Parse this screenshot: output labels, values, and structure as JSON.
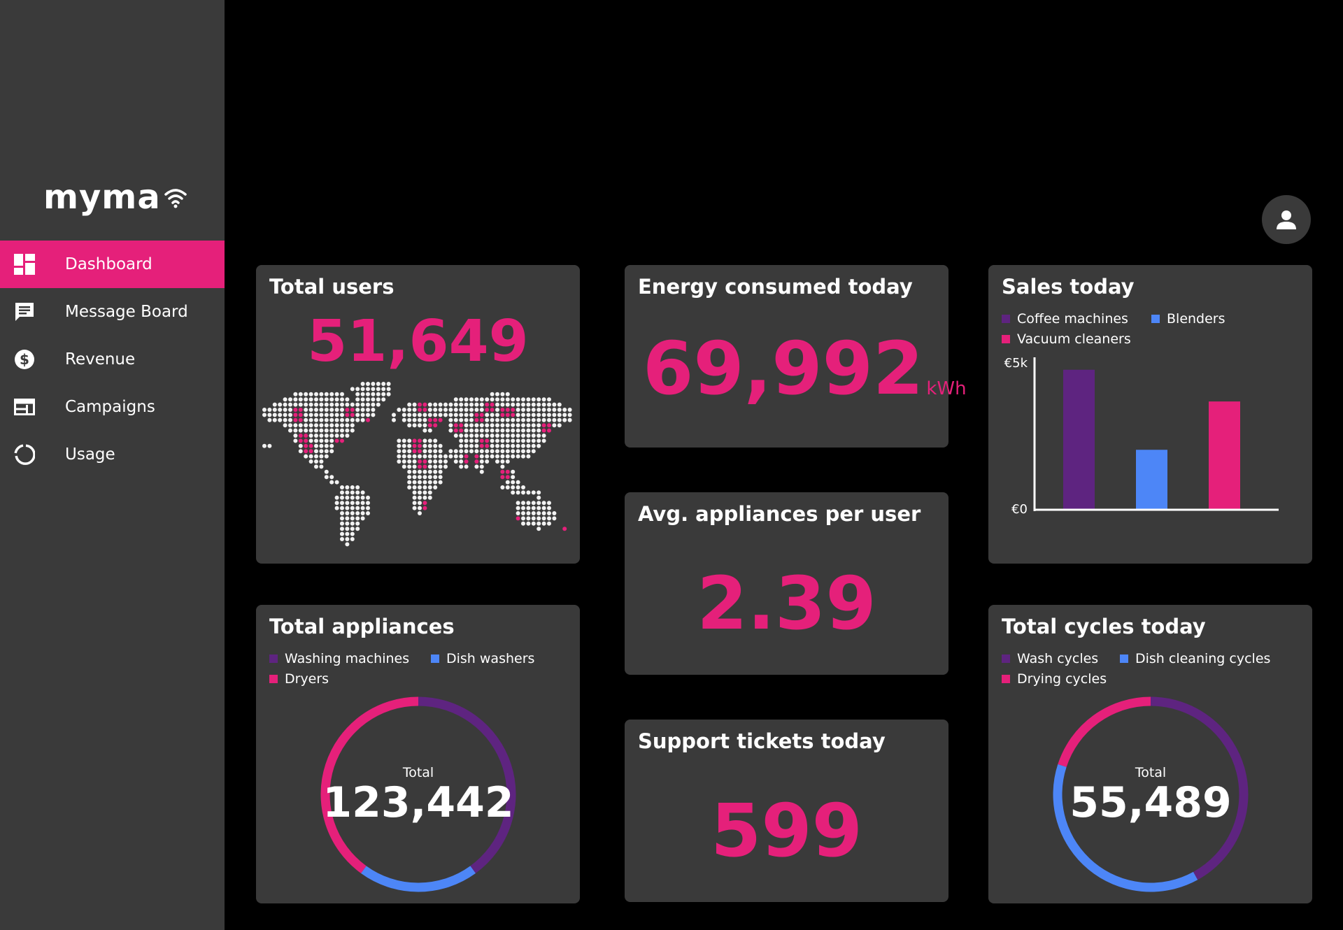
{
  "app": {
    "name": "myma"
  },
  "sidebar": {
    "items": [
      {
        "label": "Dashboard",
        "icon": "dashboard-icon",
        "active": true
      },
      {
        "label": "Message Board",
        "icon": "message-icon",
        "active": false
      },
      {
        "label": "Revenue",
        "icon": "dollar-icon",
        "active": false
      },
      {
        "label": "Campaigns",
        "icon": "campaigns-icon",
        "active": false
      },
      {
        "label": "Usage",
        "icon": "usage-icon",
        "active": false
      }
    ]
  },
  "header": {
    "avatar_icon": "user-icon"
  },
  "colors": {
    "accent": "#e5207a",
    "purple": "#5e2480",
    "blue": "#4d86f7",
    "card": "#3a3a3a",
    "sidebar": "#3a3a3a"
  },
  "cards": {
    "total_users": {
      "title": "Total users",
      "value": "51,649"
    },
    "energy": {
      "title": "Energy consumed today",
      "value": "69,992",
      "unit": "kWh"
    },
    "avg_appliances": {
      "title": "Avg. appliances per user",
      "value": "2.39"
    },
    "support": {
      "title": "Support tickets today",
      "value": "599"
    },
    "sales": {
      "title": "Sales today",
      "legend": [
        "Coffee machines",
        "Blenders",
        "Vacuum cleaners"
      ]
    },
    "total_appliances": {
      "title": "Total appliances",
      "legend": [
        "Washing machines",
        "Dish washers",
        "Dryers"
      ],
      "center_label": "Total",
      "center_value": "123,442"
    },
    "total_cycles": {
      "title": "Total cycles today",
      "legend": [
        "Wash cycles",
        "Dish cleaning cycles",
        "Drying cycles"
      ],
      "center_label": "Total",
      "center_value": "55,489"
    }
  },
  "chart_data": [
    {
      "type": "bar",
      "categories": [
        "Coffee machines",
        "Blenders",
        "Vacuum cleaners"
      ],
      "values": [
        4600,
        1950,
        3550
      ],
      "colors": [
        "#5e2480",
        "#4d86f7",
        "#e5207a"
      ],
      "ylim": [
        0,
        5000
      ],
      "ytick_labels": [
        "€0",
        "€5k"
      ],
      "title": "Sales today",
      "legend": "top-left"
    },
    {
      "type": "pie",
      "labels": [
        "Washing machines",
        "Dish washers",
        "Dryers"
      ],
      "fractions": [
        0.4,
        0.2,
        0.4
      ],
      "colors": [
        "#5e2480",
        "#4d86f7",
        "#e5207a"
      ],
      "title": "Total appliances"
    },
    {
      "type": "pie",
      "labels": [
        "Wash cycles",
        "Dish cleaning cycles",
        "Drying cycles"
      ],
      "fractions": [
        0.42,
        0.38,
        0.2
      ],
      "colors": [
        "#5e2480",
        "#4d86f7",
        "#e5207a"
      ],
      "title": "Total cycles today"
    }
  ]
}
